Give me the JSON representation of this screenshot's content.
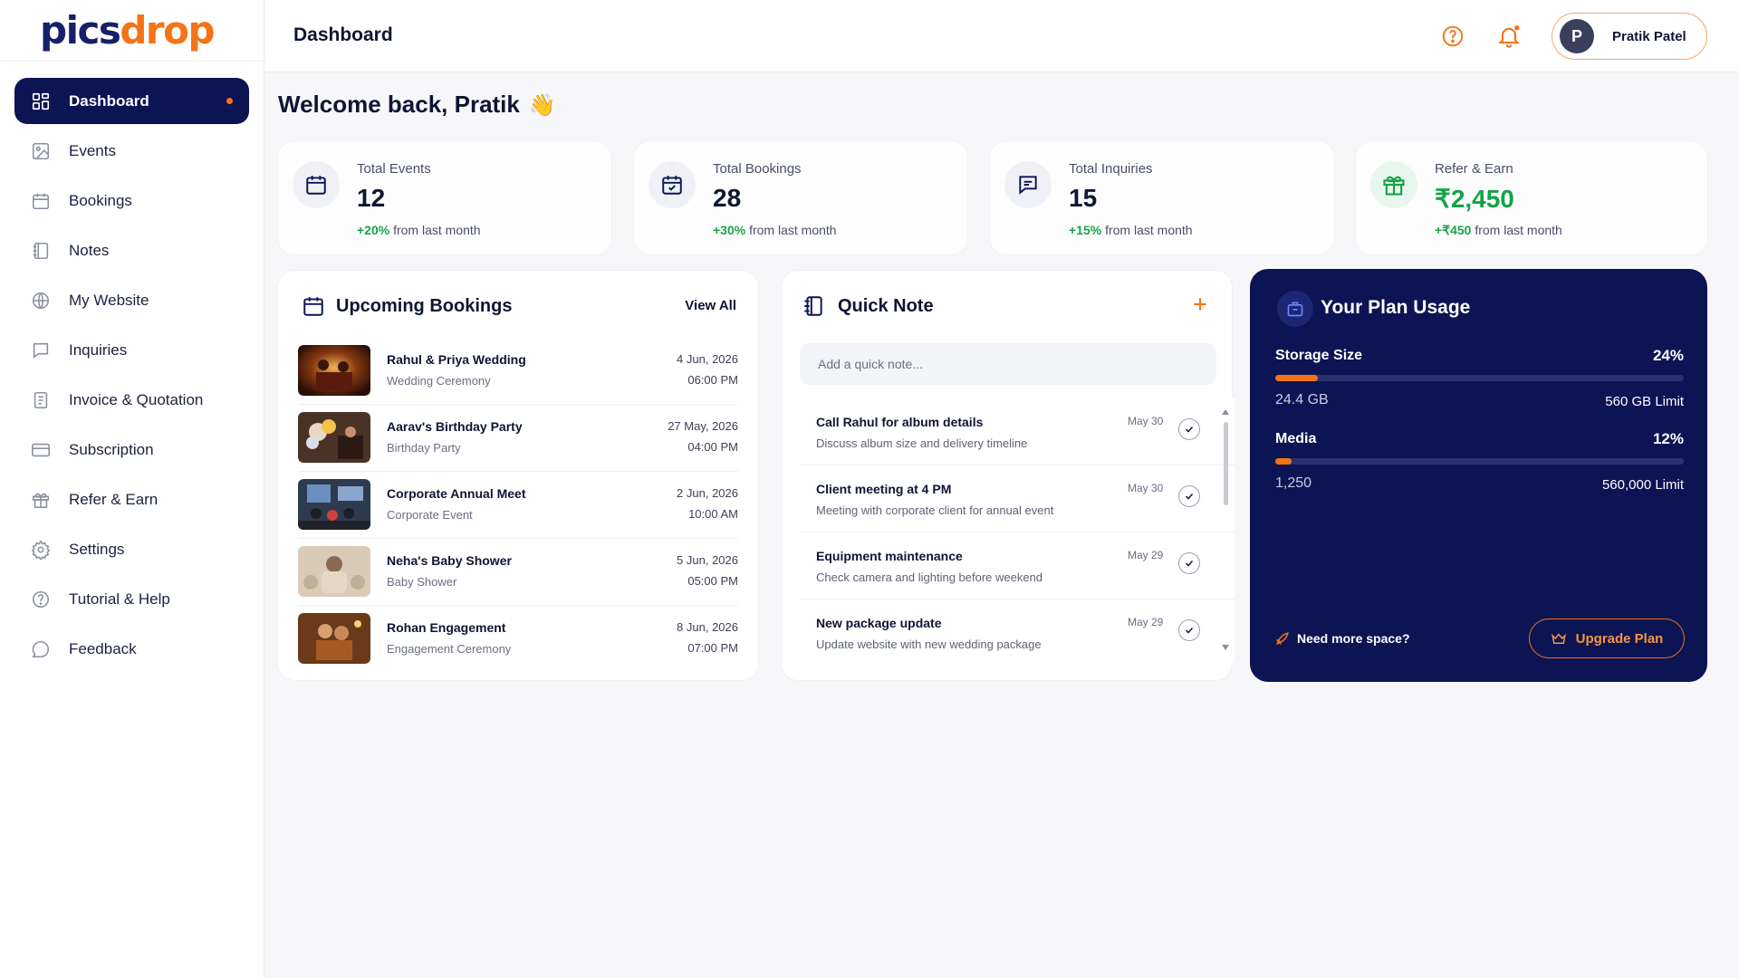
{
  "brand": {
    "logo_part1": "pics",
    "logo_part2": "drop"
  },
  "colors": {
    "navy": "#0c1454",
    "accent": "#f47316",
    "positive": "#13a348"
  },
  "sidebar": {
    "items": [
      {
        "label": "Dashboard",
        "icon": "grid-icon",
        "active": true
      },
      {
        "label": "Events",
        "icon": "image-icon"
      },
      {
        "label": "Bookings",
        "icon": "calendar-icon"
      },
      {
        "label": "Notes",
        "icon": "notebook-icon"
      },
      {
        "label": "My Website",
        "icon": "globe-icon"
      },
      {
        "label": "Inquiries",
        "icon": "chat-icon"
      },
      {
        "label": "Invoice & Quotation",
        "icon": "document-icon"
      },
      {
        "label": "Subscription",
        "icon": "card-icon"
      },
      {
        "label": "Refer & Earn",
        "icon": "gift-icon"
      },
      {
        "label": "Settings",
        "icon": "gear-icon"
      },
      {
        "label": "Tutorial & Help",
        "icon": "help-icon"
      },
      {
        "label": "Feedback",
        "icon": "feedback-icon"
      }
    ]
  },
  "header": {
    "title": "Dashboard",
    "user_initial": "P",
    "user_name": "Pratik Patel"
  },
  "welcome": {
    "text": "Welcome back, Pratik",
    "emoji": "👋"
  },
  "stats": [
    {
      "label": "Total Events",
      "value": "12",
      "delta": "+20%",
      "delta_text": "from last month"
    },
    {
      "label": "Total Bookings",
      "value": "28",
      "delta": "+30%",
      "delta_text": "from last month"
    },
    {
      "label": "Total Inquiries",
      "value": "15",
      "delta": "+15%",
      "delta_text": "from last month"
    },
    {
      "label": "Refer & Earn",
      "value": "₹2,450",
      "delta": "+₹450",
      "delta_text": "from last month"
    }
  ],
  "bookings": {
    "title": "Upcoming Bookings",
    "view_all": "View All",
    "items": [
      {
        "name": "Rahul & Priya Wedding",
        "type": "Wedding Ceremony",
        "date": "4 Jun, 2026",
        "time": "06:00 PM"
      },
      {
        "name": "Aarav's Birthday Party",
        "type": "Birthday Party",
        "date": "27 May, 2026",
        "time": "04:00 PM"
      },
      {
        "name": "Corporate Annual Meet",
        "type": "Corporate Event",
        "date": "2 Jun, 2026",
        "time": "10:00 AM"
      },
      {
        "name": "Neha's Baby Shower",
        "type": "Baby Shower",
        "date": "5 Jun, 2026",
        "time": "05:00 PM"
      },
      {
        "name": "Rohan Engagement",
        "type": "Engagement Ceremony",
        "date": "8 Jun, 2026",
        "time": "07:00 PM"
      }
    ]
  },
  "quick_note": {
    "title": "Quick Note",
    "placeholder": "Add a quick note...",
    "items": [
      {
        "title": "Call Rahul for album details",
        "sub": "Discuss album size and delivery timeline",
        "date": "May 30"
      },
      {
        "title": "Client meeting at 4 PM",
        "sub": "Meeting with corporate client for annual event",
        "date": "May 30"
      },
      {
        "title": "Equipment maintenance",
        "sub": "Check camera and lighting before weekend",
        "date": "May 29"
      },
      {
        "title": "New package update",
        "sub": "Update website with new wedding package",
        "date": "May 29"
      }
    ]
  },
  "plan": {
    "title": "Your Plan Usage",
    "storage": {
      "label": "Storage Size",
      "pct": "24%",
      "fraction": 0.105,
      "used": "24.4 GB",
      "limit": "560 GB Limit"
    },
    "media": {
      "label": "Media",
      "pct": "12%",
      "fraction": 0.04,
      "used": "1,250",
      "limit": "560,000 Limit"
    },
    "need_more": "Need more space?",
    "upgrade": "Upgrade Plan"
  }
}
